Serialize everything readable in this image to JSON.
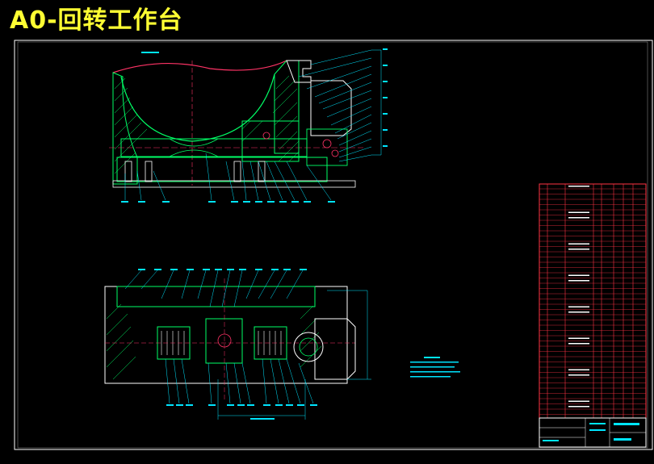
{
  "title": "A0-回转工作台",
  "colors": {
    "background": "#000000",
    "title": "#ffff33",
    "frame": "#ffffff",
    "geometry": "#00ff66",
    "leader": "#00e5ff",
    "outline": "#ffffff",
    "cut_line": "#ff3366",
    "bill_of_materials_lines": "#ff3344",
    "bill_of_materials_text": "#ffffff"
  }
}
